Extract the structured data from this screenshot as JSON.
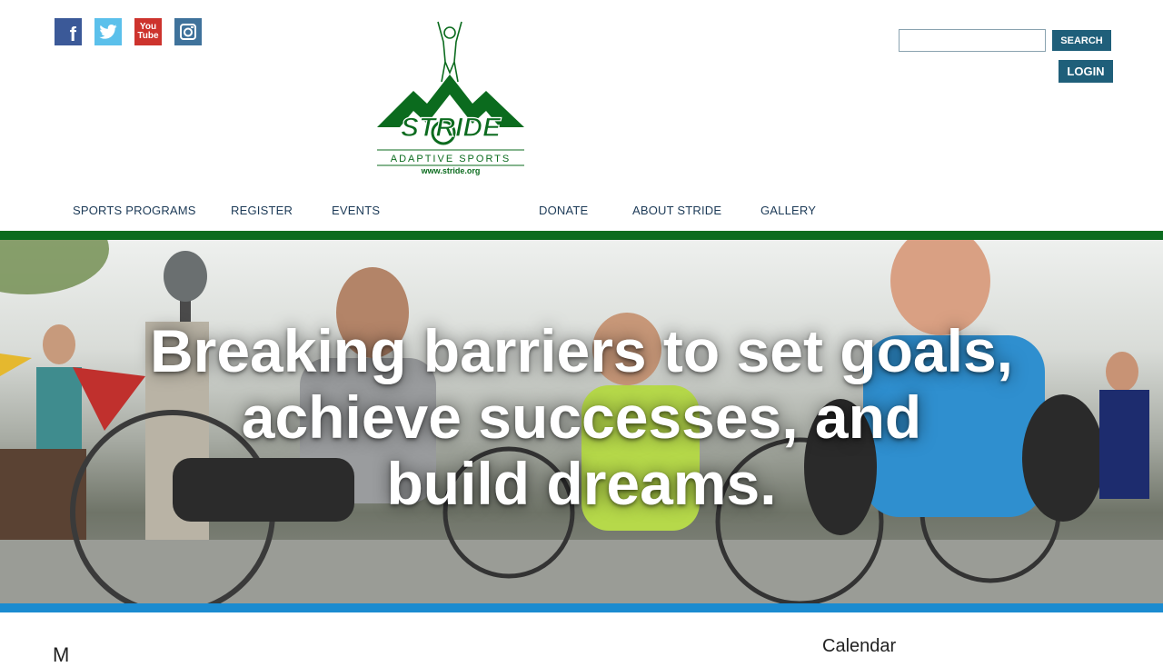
{
  "social": {
    "facebook_glyph": "f",
    "youtube_glyph_top": "You",
    "youtube_glyph_bottom": "Tube"
  },
  "logo": {
    "brand": "STRIDE",
    "subtitle": "ADAPTIVE SPORTS",
    "url": "www.stride.org",
    "color": "#0b6b1e"
  },
  "search": {
    "placeholder": "",
    "button_label": "SEARCH"
  },
  "login_label": "LOGIN",
  "nav": {
    "items": [
      {
        "label": "SPORTS PROGRAMS"
      },
      {
        "label": "REGISTER"
      },
      {
        "label": "EVENTS"
      },
      {
        "label": "DONATE"
      },
      {
        "label": "ABOUT STRIDE"
      },
      {
        "label": "GALLERY"
      }
    ]
  },
  "hero": {
    "lines": [
      "Breaking barriers to set goals,",
      "achieve successes, and",
      "build dreams."
    ]
  },
  "main": {
    "heading_partial": "M",
    "calendar_heading": "Calendar"
  },
  "colors": {
    "nav_text": "#1c3a57",
    "button_bg": "#1f5f7a",
    "green_bar": "#0b6b1e",
    "blue_bar": "#1b8bd0"
  }
}
